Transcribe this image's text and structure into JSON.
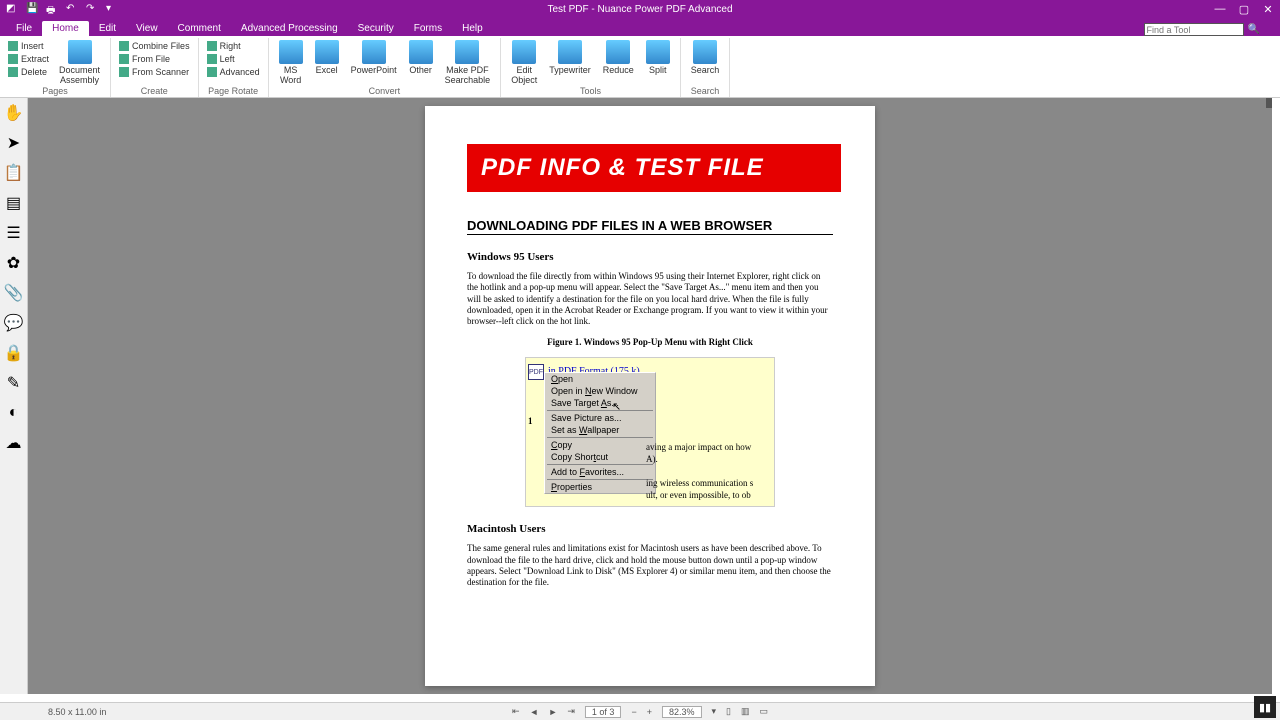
{
  "title": "Test PDF - Nuance Power PDF Advanced",
  "menus": [
    "File",
    "Home",
    "Edit",
    "View",
    "Comment",
    "Advanced Processing",
    "Security",
    "Forms",
    "Help"
  ],
  "find_tool_placeholder": "Find a Tool",
  "ribbon": {
    "pages": {
      "label": "Pages",
      "insert": "Insert",
      "extract": "Extract",
      "delete": "Delete"
    },
    "create": {
      "label": "Create",
      "combine": "Combine Files",
      "from_file": "From File",
      "from_scanner": "From Scanner",
      "assembly": "Document\nAssembly"
    },
    "rotate": {
      "label": "Page Rotate",
      "right": "Right",
      "left": "Left",
      "advanced": "Advanced"
    },
    "convert": {
      "label": "Convert",
      "word": "MS\nWord",
      "excel": "Excel",
      "ppt": "PowerPoint",
      "other": "Other",
      "searchable": "Make PDF\nSearchable"
    },
    "tools": {
      "label": "Tools",
      "editobj": "Edit\nObject",
      "typewriter": "Typewriter",
      "reduce": "Reduce",
      "split": "Split"
    },
    "search": {
      "label": "Search",
      "search": "Search"
    }
  },
  "doc": {
    "banner": "PDF INFO & TEST FILE",
    "h1": "DOWNLOADING PDF FILES IN A WEB BROWSER",
    "win_h": "Windows 95 Users",
    "win_p": "To download the file directly from within Windows 95 using their Internet Explorer, right click on the hotlink and a pop-up menu will appear. Select the \"Save Target As...\" menu item and then you will be asked to identify a destination for the file on you local hard drive. When the file is fully downloaded, open it in the Acrobat Reader or Exchange program. If you want to view it within your browser--left click on the hot link.",
    "fig": "Figure 1. Windows 95 Pop-Up Menu with Right Click",
    "mac_h": "Macintosh Users",
    "mac_p": "The same general rules and limitations exist for Macintosh users as have been described above. To download the file to the hard drive, click and hold the mouse button down until a pop-up window appears. Select \"Download Link to Disk\" (MS Explorer 4) or similar menu item, and then choose the destination for the file."
  },
  "embed": {
    "link_partial": "in PDF Format (175 k)",
    "num": "1",
    "t1": "aving a major impact on how",
    "t2": "A).",
    "t3": "ing wireless communication s",
    "t4": "ult, or even impossible, to ob",
    "menu": {
      "open": "Open",
      "new_window": "Open in New Window",
      "save_target": "Save Target As...",
      "save_picture": "Save Picture as...",
      "wallpaper": "Set as Wallpaper",
      "copy": "Copy",
      "copy_shortcut": "Copy Shortcut",
      "favorites": "Add to Favorites...",
      "properties": "Properties"
    }
  },
  "status": {
    "dimensions": "8.50 x 11.00 in",
    "page": "1 of 3",
    "zoom": "82.3%"
  }
}
